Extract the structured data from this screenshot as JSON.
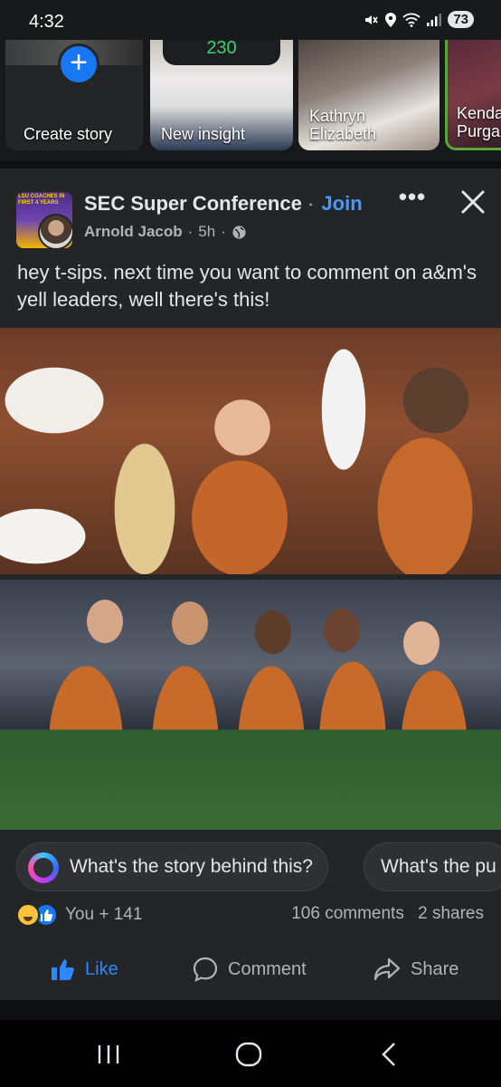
{
  "status_bar": {
    "time": "4:32",
    "battery": "73",
    "icons": [
      "mute-icon",
      "location-icon",
      "wifi-icon",
      "signal-icon"
    ]
  },
  "stories": {
    "create_label": "Create story",
    "items": [
      {
        "label": "New insight",
        "badge": "230"
      },
      {
        "label": "Kathryn Elizabeth"
      },
      {
        "label": "Kenda Purga"
      }
    ]
  },
  "post": {
    "group_name": "SEC Super Conference",
    "separator": "·",
    "join_label": "Join",
    "author": "Arnold Jacob",
    "time": "5h",
    "meta_separator": "·",
    "more_label": "•••",
    "text": "hey t-sips. next time you want to comment on a&m's yell leaders, well there's this!",
    "avatar_text": "LSU COACHES IN FIRST 4 YEARS"
  },
  "ai_prompts": [
    "What's the story behind this?",
    "What's the pu"
  ],
  "reactions": {
    "names": "You + 141",
    "comments": "106 comments",
    "shares": "2 shares"
  },
  "actions": {
    "like": "Like",
    "comment": "Comment",
    "share": "Share"
  },
  "colors": {
    "background": "#18191a",
    "card": "#242526",
    "accent_blue": "#2d88ff",
    "secondary_text": "#b0b3b8",
    "primary_text": "#e4e6eb"
  }
}
